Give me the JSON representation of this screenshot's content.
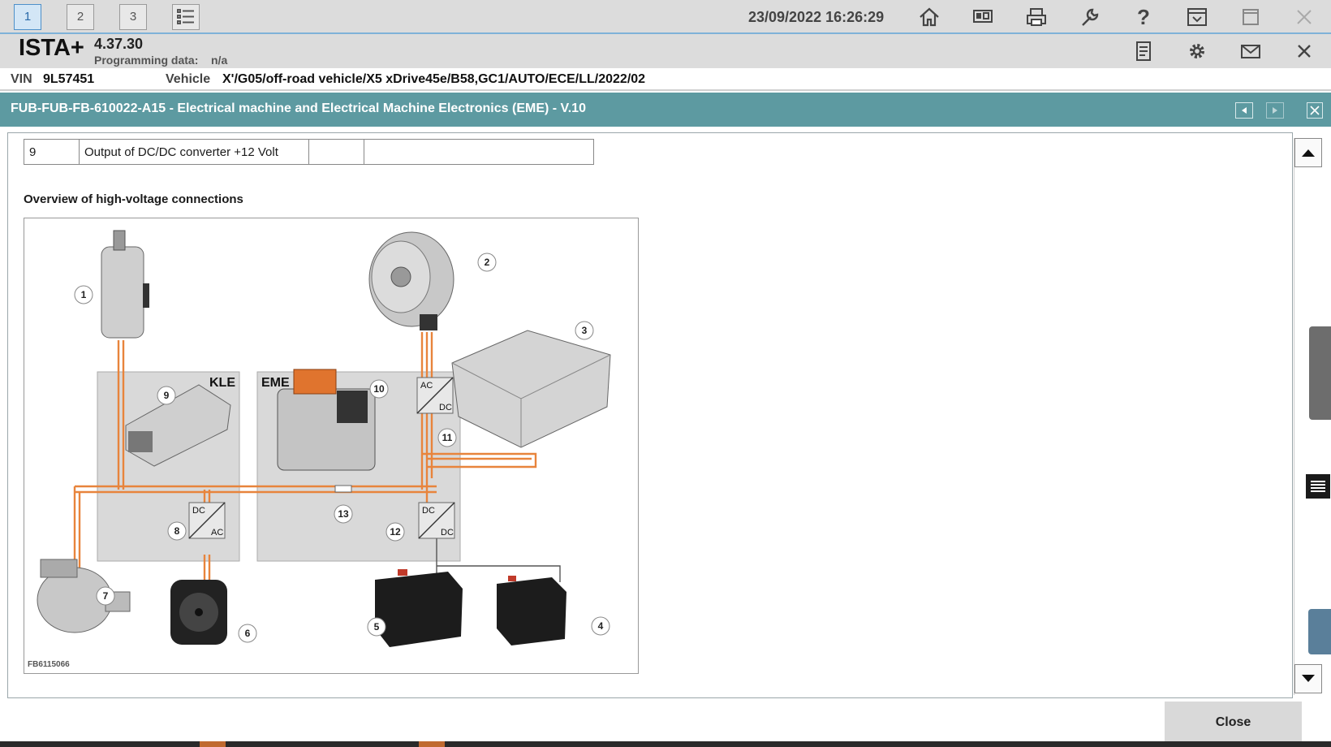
{
  "toolbar": {
    "tabs": [
      "1",
      "2",
      "3"
    ],
    "datetime": "23/09/2022 16:26:29",
    "icons": [
      "list-icon",
      "home-icon",
      "compare-icon",
      "print-icon",
      "wrench-icon",
      "help-icon",
      "download-icon",
      "window-icon",
      "close-icon"
    ]
  },
  "header": {
    "brand": "ISTA+",
    "version": "4.37.30",
    "programming_label": "Programming data:",
    "programming_value": "n/a",
    "icons": [
      "document-icon",
      "gear-icon",
      "mail-icon",
      "close-icon"
    ]
  },
  "vehicle": {
    "vin_label": "VIN",
    "vin_value": "9L57451",
    "vehicle_label": "Vehicle",
    "vehicle_value": "X'/G05/off-road vehicle/X5 xDrive45e/B58,GC1/AUTO/ECE/LL/2022/02"
  },
  "dialog": {
    "title": "FUB-FUB-FB-610022-A15 - Electrical machine and Electrical Machine Electronics (EME) - V.10",
    "table_row": {
      "number": "9",
      "description": "Output of DC/DC converter +12 Volt",
      "col3": "",
      "col4": ""
    },
    "section_title": "Overview of high-voltage connections",
    "close_label": "Close"
  },
  "diagram": {
    "box_labels": {
      "kle": "KLE",
      "eme": "EME"
    },
    "converter_labels": {
      "ac": "AC",
      "dc": "DC"
    },
    "callouts": [
      "1",
      "2",
      "3",
      "4",
      "5",
      "6",
      "7",
      "8",
      "9",
      "10",
      "11",
      "12",
      "13"
    ],
    "figure_id": "FB6115066",
    "colors": {
      "hv_cable": "#e8843c",
      "box_fill": "#d9d9d9"
    }
  },
  "colors": {
    "title_bar": "#5d9aa1",
    "toolbar": "#dcdcdc",
    "active_tab": "#4e90c9"
  }
}
